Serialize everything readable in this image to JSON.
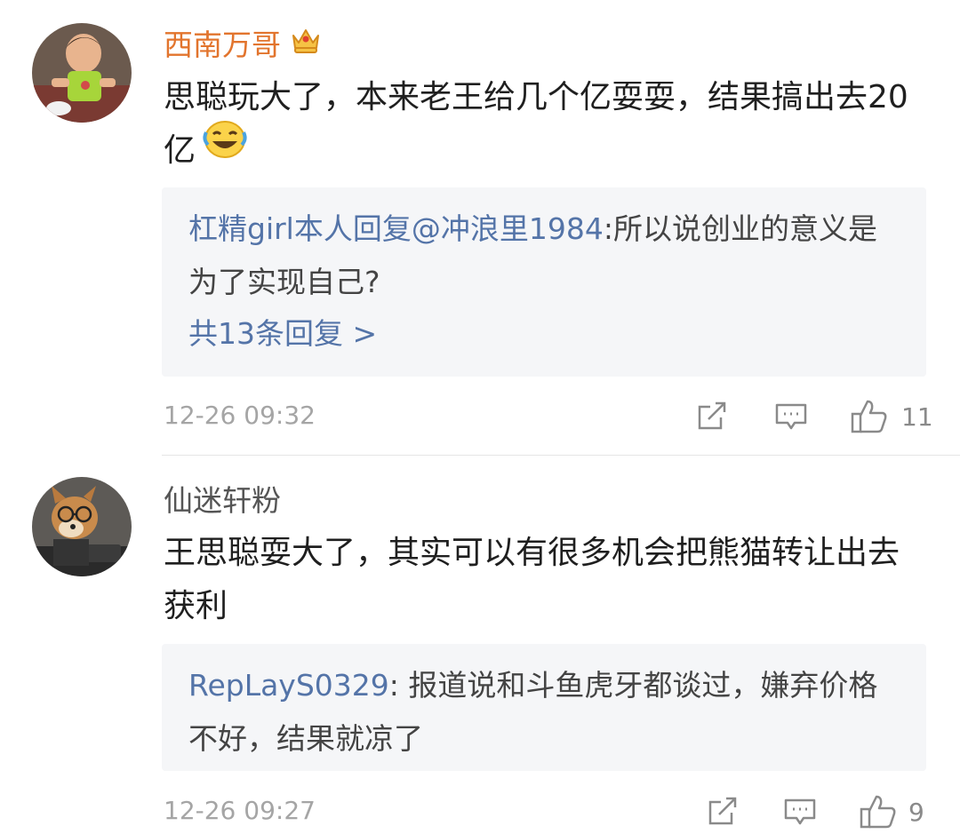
{
  "comments": [
    {
      "username": "西南万哥",
      "text": "思聪玩大了，本来老王给几个亿耍耍，结果搞出去20亿",
      "reply": {
        "name": "杠精girl本人回复@冲浪里1984",
        "text": ":所以说创业的意义是为了实现自己?"
      },
      "reply_count": "共13条回复 >",
      "time": "12-26 09:32",
      "likes": "11"
    },
    {
      "username": "仙迷轩粉",
      "text": "王思聪耍大了，其实可以有很多机会把熊猫转让出去获利",
      "reply": {
        "name": "RepLayS0329",
        "text": ": 报道说和斗鱼虎牙都谈过，嫌弃价格不好，结果就凉了"
      },
      "time": "12-26 09:27",
      "likes": "9"
    }
  ],
  "icons": {
    "vip_badge": "crown-icon",
    "emoji": "laugh-cry-emoji",
    "share": "share-icon",
    "comment": "comment-icon",
    "like": "thumbs-up-icon"
  },
  "colors": {
    "vip_name": "#e2742d",
    "link": "#5474a8",
    "reply_bg": "#f5f6f8"
  }
}
